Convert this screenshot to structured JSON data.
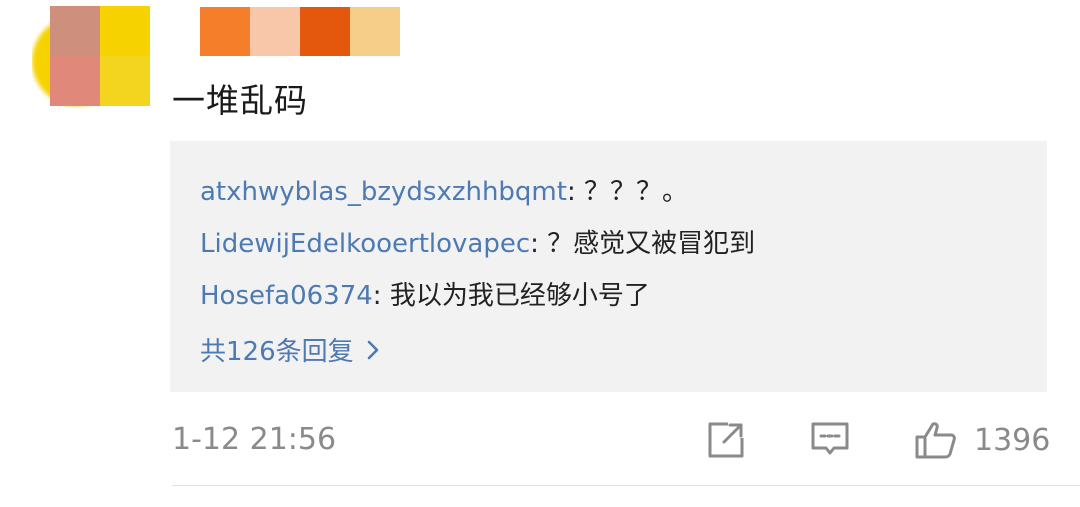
{
  "comment": {
    "text": "一堆乱码",
    "replies": [
      {
        "user": "atxhwyblas_bzydsxzhhbqmt",
        "text": ": ？？？。"
      },
      {
        "user": "LidewijEdelkooertlovapec",
        "text": ": ？感觉又被冒犯到"
      },
      {
        "user": "Hosefa06374",
        "text": ": 我以为我已经够小号了"
      }
    ],
    "more_replies": "共126条回复",
    "timestamp": "1-12 21:56",
    "likes": "1396"
  },
  "colors": {
    "link": "#4d7ab2",
    "meta": "#8a8a8a",
    "reply_bg": "#f2f2f2"
  },
  "icons": {
    "share": "share-icon",
    "comment": "comment-icon",
    "like": "thumbs-up-icon",
    "more": "chevron-right-icon"
  }
}
